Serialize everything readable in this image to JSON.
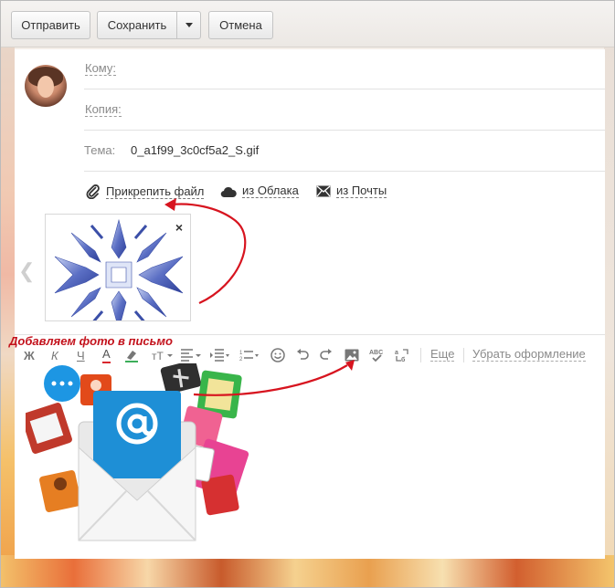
{
  "toolbar": {
    "send_label": "Отправить",
    "save_label": "Сохранить",
    "cancel_label": "Отмена"
  },
  "compose": {
    "to_label": "Кому:",
    "cc_label": "Копия:",
    "subject_label": "Тема:",
    "subject_value": "0_a1f99_3c0cf5a2_S.gif"
  },
  "attachments": {
    "attach_file_label": "Прикрепить файл",
    "from_cloud_label": "из Облака",
    "from_mail_label": "из Почты",
    "close_symbol": "×"
  },
  "format_bar": {
    "bold": "Ж",
    "italic": "К",
    "underline": "Ч",
    "text_color": "A",
    "more_label": "Еще",
    "clear_format_label": "Убрать оформление"
  },
  "annotation": {
    "callout_text": "Добавляем фото в письмо",
    "arrow_color": "#d7141f"
  },
  "icons": [
    "paperclip-icon",
    "cloud-icon",
    "envelope-icon",
    "close-icon",
    "chevron-left-icon",
    "smiley-icon",
    "undo-icon",
    "redo-icon",
    "insert-image-icon",
    "spellcheck-icon",
    "translit-icon"
  ]
}
